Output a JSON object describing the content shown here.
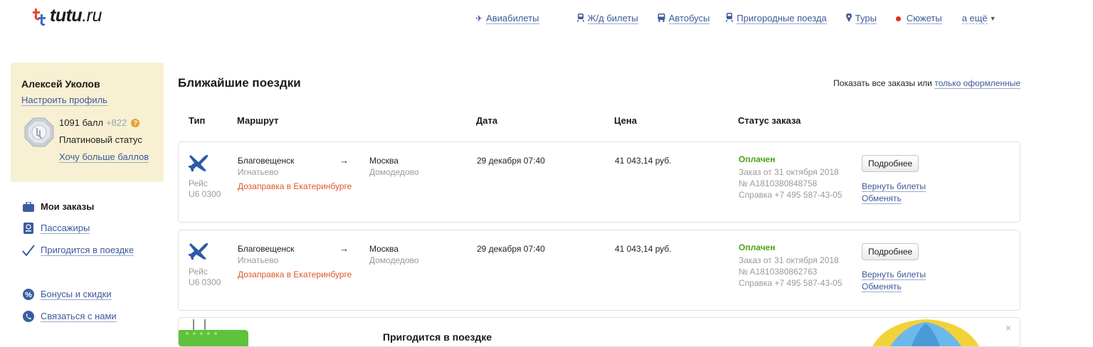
{
  "header": {
    "logo_text": "tutu",
    "logo_suffix": ".ru",
    "nav": [
      {
        "label": "Авиабилеты",
        "icon": "plane-icon"
      },
      {
        "label": "Ж/д билеты",
        "icon": "train-icon"
      },
      {
        "label": "Автобусы",
        "icon": "bus-icon"
      },
      {
        "label": "Пригородные поезда",
        "icon": "suburban-train-icon"
      },
      {
        "label": "Туры",
        "icon": "pin-icon"
      },
      {
        "label": "Сюжеты",
        "icon": "red-dot-icon"
      }
    ],
    "more": "а ещё"
  },
  "profile": {
    "name": "Алексей Уколов",
    "settings": "Настроить профиль",
    "points": "1091 балл",
    "points_plus": "+822",
    "status": "Платиновый статус",
    "more_points": "Хочу больше баллов"
  },
  "sidebar": {
    "items": [
      {
        "label": "Мои заказы",
        "icon": "briefcase-icon"
      },
      {
        "label": "Пассажиры",
        "icon": "passport-icon"
      },
      {
        "label": "Пригодится в поездке",
        "icon": "checkmark-icon"
      },
      {
        "label": "Бонусы и скидки",
        "icon": "percent-icon"
      },
      {
        "label": "Связаться с нами",
        "icon": "phone-icon"
      }
    ]
  },
  "main": {
    "title": "Ближайшие поездки",
    "show_all_prefix": "Показать все заказы или",
    "show_all_link": "только оформленные",
    "columns": [
      "Тип",
      "Маршрут",
      "Дата",
      "Цена",
      "Статус заказа"
    ],
    "trips": [
      {
        "flight_label": "Рейс",
        "flight_no": "U6 0300",
        "from": "Благовещенск",
        "from_airport": "Игнатьево",
        "arrow": "→",
        "to": "Москва",
        "to_airport": "Домодедово",
        "note": "Дозаправка в Екатеринбурге",
        "date": "29 декабря 07:40",
        "price": "41 043,14 руб.",
        "status": "Оплачен",
        "order_date": "Заказ от 31 октября 2018",
        "order_no": "№ A1810380848758",
        "help": "Справка +7 495 587-43-05",
        "details_btn": "Подробнее",
        "return_link": "Вернуть билеты",
        "exchange_link": "Обменять"
      },
      {
        "flight_label": "Рейс",
        "flight_no": "U6 0300",
        "from": "Благовещенск",
        "from_airport": "Игнатьево",
        "arrow": "→",
        "to": "Москва",
        "to_airport": "Домодедово",
        "note": "Дозаправка в Екатеринбурге",
        "date": "29 декабря 07:40",
        "price": "41 043,14 руб.",
        "status": "Оплачен",
        "order_date": "Заказ от 31 октября 2018",
        "order_no": "№ A1810380862763",
        "help": "Справка +7 495 587-43-05",
        "details_btn": "Подробнее",
        "return_link": "Вернуть билеты",
        "exchange_link": "Обменять"
      }
    ],
    "promo_title": "Пригодится в поездке",
    "promo_close": "×"
  },
  "colors": {
    "link": "#3d5a99",
    "profile_bg": "#f7f0d3",
    "paid": "#4aa217",
    "refuel": "#e0552a",
    "accent_red": "#e0301e"
  }
}
